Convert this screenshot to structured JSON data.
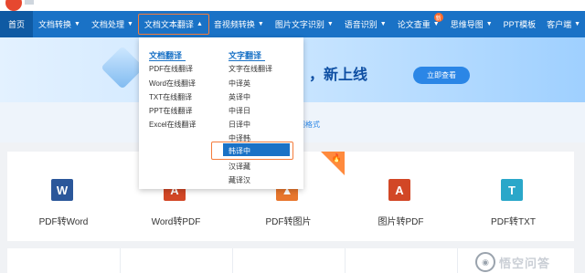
{
  "nav": {
    "items": [
      {
        "label": "首页",
        "caret": ""
      },
      {
        "label": "文档转换",
        "caret": "▼"
      },
      {
        "label": "文档处理",
        "caret": "▼"
      },
      {
        "label": "文档文本翻译",
        "caret": "▲"
      },
      {
        "label": "音视频转换",
        "caret": "▼"
      },
      {
        "label": "图片文字识别",
        "caret": "▼"
      },
      {
        "label": "语音识别",
        "caret": "▼"
      },
      {
        "label": "论文查重",
        "caret": "▼",
        "badge": "新"
      },
      {
        "label": "思维导图",
        "caret": "▼"
      },
      {
        "label": "PPT模板",
        "caret": ""
      },
      {
        "label": "客户端",
        "caret": "▼"
      }
    ]
  },
  "banner": {
    "headline": "，新上线",
    "button": "立即查看"
  },
  "tip": {
    "text": "图格式"
  },
  "dropdown": {
    "col1": {
      "title": "文档翻译",
      "items": [
        "PDF在线翻译",
        "Word在线翻译",
        "TXT在线翻译",
        "PPT在线翻译",
        "Excel在线翻译"
      ]
    },
    "col2": {
      "title": "文字翻译",
      "items": [
        "文字在线翻译",
        "中译英",
        "英译中",
        "中译日",
        "日译中",
        "中译韩",
        "韩译中",
        "汉译藏",
        "藏译汉"
      ]
    }
  },
  "cards": [
    {
      "label": "PDF转Word",
      "icon_text": "W",
      "icon_color": "#2b579a",
      "hot": false
    },
    {
      "label": "Word转PDF",
      "icon_text": "A",
      "icon_color": "#d24726",
      "hot": true
    },
    {
      "label": "PDF转图片",
      "icon_text": "▲",
      "icon_color": "#e8762d",
      "hot": true
    },
    {
      "label": "图片转PDF",
      "icon_text": "A",
      "icon_color": "#d24726",
      "hot": false
    },
    {
      "label": "PDF转TXT",
      "icon_text": "T",
      "icon_color": "#2aa7c9",
      "hot": false
    }
  ],
  "watermark": {
    "text": "悟空问答"
  },
  "colors": {
    "nav": "#1a72c6",
    "highlight": "#f47c3c",
    "hot": "#ff8a3d"
  }
}
